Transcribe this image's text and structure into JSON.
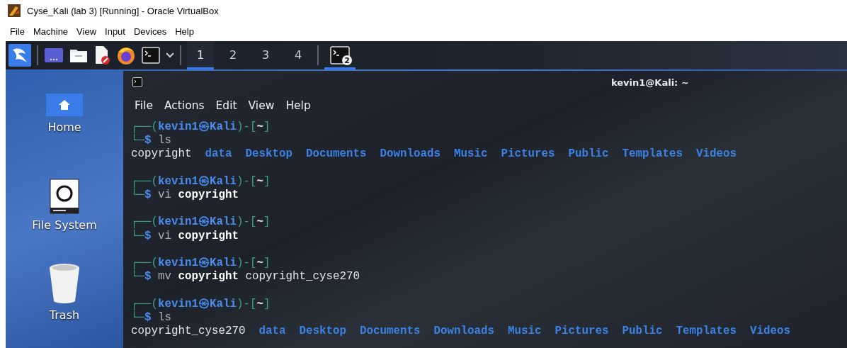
{
  "window": {
    "title": "Cyse_Kali (lab 3) [Running] - Oracle VirtualBox",
    "menu": [
      "File",
      "Machine",
      "View",
      "Input",
      "Devices",
      "Help"
    ]
  },
  "panel": {
    "workspaces": [
      {
        "label": "1",
        "selected": true
      },
      {
        "label": "2",
        "selected": false
      },
      {
        "label": "3",
        "selected": false
      },
      {
        "label": "4",
        "selected": false
      }
    ],
    "tasks": [
      {
        "badge": "2",
        "selected": true
      }
    ]
  },
  "desktop": {
    "icons": [
      {
        "label": "Home",
        "kind": "home"
      },
      {
        "label": "File System",
        "kind": "drive"
      },
      {
        "label": "Trash",
        "kind": "trash"
      }
    ]
  },
  "terminal": {
    "title": "kevin1@Kali: ~",
    "menu": [
      "File",
      "Actions",
      "Edit",
      "View",
      "Help"
    ],
    "blocks": [
      {
        "lines": [
          {
            "kind": "prompt",
            "segments": [
              {
                "text": "┌──(",
                "kind": "frame"
              },
              {
                "text": "kevin1㉿Kali",
                "kind": "user"
              },
              {
                "text": ")-[",
                "kind": "frame"
              },
              {
                "text": "~",
                "kind": "dir"
              },
              {
                "text": "]",
                "kind": "frame"
              }
            ]
          },
          {
            "kind": "command",
            "segments": [
              {
                "text": "└─",
                "kind": "frame"
              },
              {
                "text": "$",
                "kind": "dollar"
              },
              {
                "text": "ls",
                "kind": "program"
              }
            ]
          },
          {
            "kind": "output",
            "segments": [
              {
                "text": "copyright",
                "kind": "file"
              },
              {
                "text": "data",
                "kind": "folder"
              },
              {
                "text": "Desktop",
                "kind": "folder"
              },
              {
                "text": "Documents",
                "kind": "folder"
              },
              {
                "text": "Downloads",
                "kind": "folder"
              },
              {
                "text": "Music",
                "kind": "folder"
              },
              {
                "text": "Pictures",
                "kind": "folder"
              },
              {
                "text": "Public",
                "kind": "folder"
              },
              {
                "text": "Templates",
                "kind": "folder"
              },
              {
                "text": "Videos",
                "kind": "folder"
              }
            ]
          }
        ]
      },
      {
        "lines": [
          {
            "kind": "prompt",
            "segments": [
              {
                "text": "┌──(",
                "kind": "frame"
              },
              {
                "text": "kevin1㉿Kali",
                "kind": "user"
              },
              {
                "text": ")-[",
                "kind": "frame"
              },
              {
                "text": "~",
                "kind": "dir"
              },
              {
                "text": "]",
                "kind": "frame"
              }
            ]
          },
          {
            "kind": "command",
            "segments": [
              {
                "text": "└─",
                "kind": "frame"
              },
              {
                "text": "$",
                "kind": "dollar"
              },
              {
                "text": "vi",
                "kind": "program"
              },
              {
                "text": "copyright",
                "kind": "bold"
              }
            ]
          }
        ]
      },
      {
        "lines": [
          {
            "kind": "prompt",
            "segments": [
              {
                "text": "┌──(",
                "kind": "frame"
              },
              {
                "text": "kevin1㉿Kali",
                "kind": "user"
              },
              {
                "text": ")-[",
                "kind": "frame"
              },
              {
                "text": "~",
                "kind": "dir"
              },
              {
                "text": "]",
                "kind": "frame"
              }
            ]
          },
          {
            "kind": "command",
            "segments": [
              {
                "text": "└─",
                "kind": "frame"
              },
              {
                "text": "$",
                "kind": "dollar"
              },
              {
                "text": "vi",
                "kind": "program"
              },
              {
                "text": "copyright",
                "kind": "bold"
              }
            ]
          }
        ]
      },
      {
        "lines": [
          {
            "kind": "prompt",
            "segments": [
              {
                "text": "┌──(",
                "kind": "frame"
              },
              {
                "text": "kevin1㉿Kali",
                "kind": "user"
              },
              {
                "text": ")-[",
                "kind": "frame"
              },
              {
                "text": "~",
                "kind": "dir"
              },
              {
                "text": "]",
                "kind": "frame"
              }
            ]
          },
          {
            "kind": "command",
            "segments": [
              {
                "text": "└─",
                "kind": "frame"
              },
              {
                "text": "$",
                "kind": "dollar"
              },
              {
                "text": "mv",
                "kind": "program"
              },
              {
                "text": "copyright",
                "kind": "bold"
              },
              {
                "text": "copyright_cyse270",
                "kind": "file"
              }
            ]
          }
        ]
      },
      {
        "lines": [
          {
            "kind": "prompt",
            "segments": [
              {
                "text": "┌──(",
                "kind": "frame"
              },
              {
                "text": "kevin1㉿Kali",
                "kind": "user"
              },
              {
                "text": ")-[",
                "kind": "frame"
              },
              {
                "text": "~",
                "kind": "dir"
              },
              {
                "text": "]",
                "kind": "frame"
              }
            ]
          },
          {
            "kind": "command",
            "segments": [
              {
                "text": "└─",
                "kind": "frame"
              },
              {
                "text": "$",
                "kind": "dollar"
              },
              {
                "text": "ls",
                "kind": "program"
              }
            ]
          },
          {
            "kind": "output",
            "segments": [
              {
                "text": "copyright_cyse270",
                "kind": "file"
              },
              {
                "text": "data",
                "kind": "folder"
              },
              {
                "text": "Desktop",
                "kind": "folder"
              },
              {
                "text": "Documents",
                "kind": "folder"
              },
              {
                "text": "Downloads",
                "kind": "folder"
              },
              {
                "text": "Music",
                "kind": "folder"
              },
              {
                "text": "Pictures",
                "kind": "folder"
              },
              {
                "text": "Public",
                "kind": "folder"
              },
              {
                "text": "Templates",
                "kind": "folder"
              },
              {
                "text": "Videos",
                "kind": "folder"
              }
            ]
          }
        ]
      }
    ]
  }
}
